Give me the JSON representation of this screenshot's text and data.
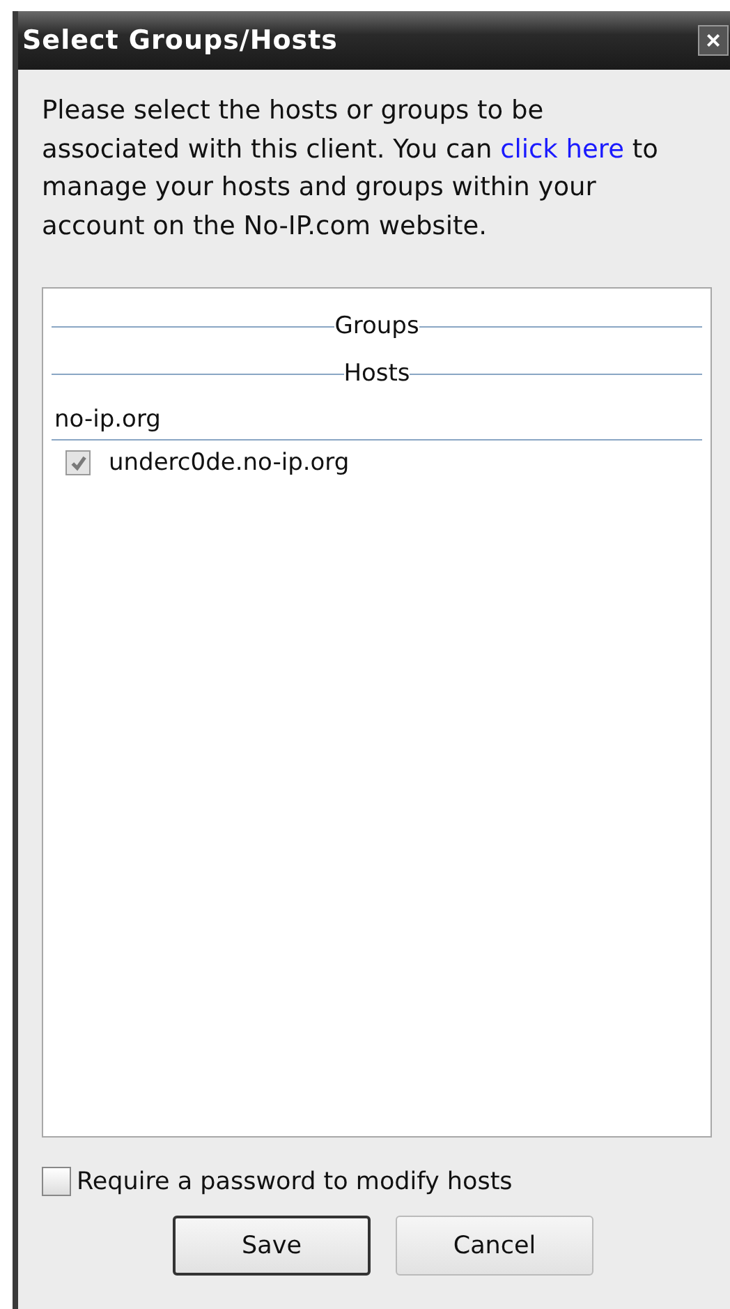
{
  "window": {
    "title": "Select Groups/Hosts",
    "close": "×"
  },
  "intro": {
    "before": "Please select the hosts or groups to be associated with this client.  You can ",
    "link": "click here",
    "after": " to manage your hosts and groups within your account on the No-IP.com website."
  },
  "list": [
    {
      "kind": "section",
      "label": "Groups"
    },
    {
      "kind": "section",
      "label": "Hosts"
    },
    {
      "kind": "domain",
      "label": "no-ip.org"
    },
    {
      "kind": "host",
      "label": "underc0de.no-ip.org",
      "checked": true,
      "disabled": true
    }
  ],
  "password_option": {
    "label": "Require a password to modify hosts",
    "checked": false
  },
  "buttons": [
    {
      "label": "Save",
      "default": true
    },
    {
      "label": "Cancel",
      "default": false
    }
  ]
}
